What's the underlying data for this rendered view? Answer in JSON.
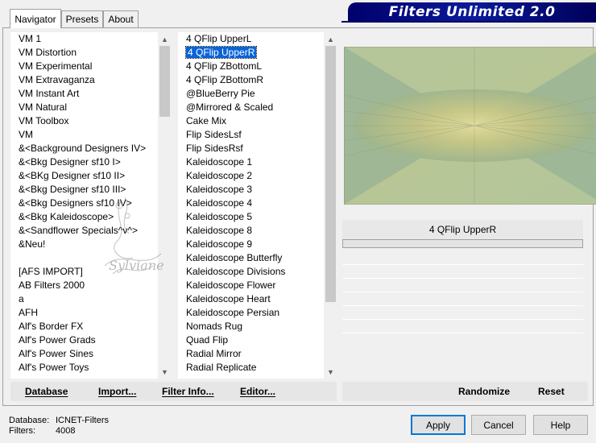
{
  "tabs": [
    {
      "label": "Navigator",
      "active": true
    },
    {
      "label": "Presets",
      "active": false
    },
    {
      "label": "About",
      "active": false
    }
  ],
  "banner": {
    "title": "Filters Unlimited 2.0"
  },
  "categories": [
    "VM 1",
    "VM Distortion",
    "VM Experimental",
    "VM Extravaganza",
    "VM Instant Art",
    "VM Natural",
    "VM Toolbox",
    "VM",
    "&<Background Designers IV>",
    "&<Bkg Designer sf10 I>",
    "&<BKg Designer sf10 II>",
    "&<Bkg Designer sf10 III>",
    "&<Bkg Designers sf10 IV>",
    "&<Bkg Kaleidoscope>",
    "&<Sandflower Specials^v^>",
    "&Neu!",
    "",
    "[AFS IMPORT]",
    "AB Filters 2000",
    "a",
    "AFH",
    "Alf's Border FX",
    "Alf's Power Grads",
    "Alf's Power Sines",
    "Alf's Power Toys"
  ],
  "filters": [
    "4 QFlip UpperL",
    "4 QFlip UpperR",
    "4 QFlip ZBottomL",
    "4 QFlip ZBottomR",
    "@BlueBerry Pie",
    "@Mirrored & Scaled",
    "Cake Mix",
    "Flip SidesLsf",
    "Flip SidesRsf",
    "Kaleidoscope 1",
    "Kaleidoscope 2",
    "Kaleidoscope 3",
    "Kaleidoscope 4",
    "Kaleidoscope 5",
    "Kaleidoscope 8",
    "Kaleidoscope 9",
    "Kaleidoscope Butterfly",
    "Kaleidoscope Divisions",
    "Kaleidoscope Flower",
    "Kaleidoscope Heart",
    "Kaleidoscope Persian",
    "Nomads Rug",
    "Quad Flip",
    "Radial Mirror",
    "Radial Replicate"
  ],
  "selected_filter_index": 1,
  "selected_filter_name": "4 QFlip UpperR",
  "left_buttons": {
    "database": "Database",
    "import": "Import...",
    "filter_info": "Filter Info...",
    "editor": "Editor..."
  },
  "right_buttons": {
    "randomize": "Randomize",
    "reset": "Reset"
  },
  "status": {
    "database_label": "Database:",
    "database_value": "ICNET-Filters",
    "filters_label": "Filters:",
    "filters_value": "4008"
  },
  "dialog_buttons": {
    "apply": "Apply",
    "cancel": "Cancel",
    "help": "Help"
  },
  "watermark": {
    "text": "Sylviane"
  },
  "colors": {
    "banner": "#00006a",
    "selection": "#0a64d8",
    "preview_bg": "#a8bb8a"
  }
}
